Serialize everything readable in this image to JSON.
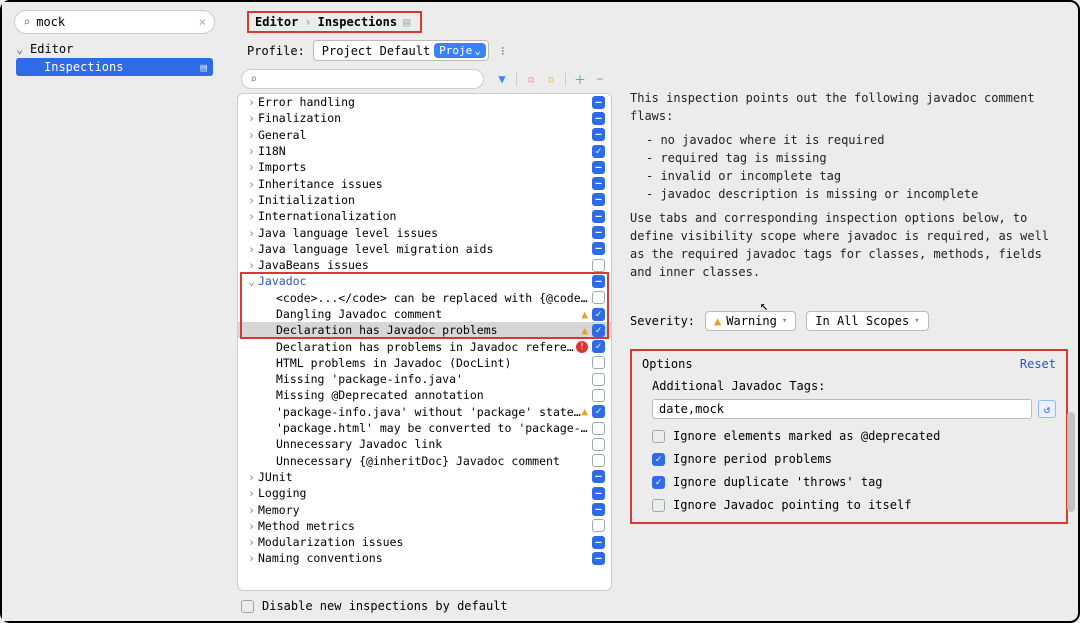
{
  "sidebar": {
    "search_value": "mock",
    "group": "Editor",
    "item": "Inspections"
  },
  "breadcrumb": {
    "root": "Editor",
    "leaf": "Inspections"
  },
  "profile": {
    "label": "Profile:",
    "name": "Project Default",
    "scope_badge": "Proje"
  },
  "tree": {
    "items": [
      {
        "label": "Error handling",
        "depth": 0,
        "expand": "right",
        "check": "mixed"
      },
      {
        "label": "Finalization",
        "depth": 0,
        "expand": "right",
        "check": "mixed"
      },
      {
        "label": "General",
        "depth": 0,
        "expand": "right",
        "check": "mixed"
      },
      {
        "label": "I18N",
        "depth": 0,
        "expand": "right",
        "check": "checked"
      },
      {
        "label": "Imports",
        "depth": 0,
        "expand": "right",
        "check": "mixed"
      },
      {
        "label": "Inheritance issues",
        "depth": 0,
        "expand": "right",
        "check": "mixed"
      },
      {
        "label": "Initialization",
        "depth": 0,
        "expand": "right",
        "check": "mixed"
      },
      {
        "label": "Internationalization",
        "depth": 0,
        "expand": "right",
        "check": "mixed"
      },
      {
        "label": "Java language level issues",
        "depth": 0,
        "expand": "right",
        "check": "mixed"
      },
      {
        "label": "Java language level migration aids",
        "depth": 0,
        "expand": "right",
        "check": "mixed"
      },
      {
        "label": "JavaBeans issues",
        "depth": 0,
        "expand": "right",
        "check": "unchecked"
      },
      {
        "label": "Javadoc",
        "depth": 0,
        "expand": "down",
        "check": "mixed",
        "link": true
      },
      {
        "label": "<code>...</code> can be replaced with {@code ...}",
        "depth": 1,
        "expand": "none",
        "check": "unchecked"
      },
      {
        "label": "Dangling Javadoc comment",
        "depth": 1,
        "expand": "none",
        "check": "checked",
        "warn": true
      },
      {
        "label": "Declaration has Javadoc problems",
        "depth": 1,
        "expand": "none",
        "check": "checked",
        "warn": true,
        "selected": true
      },
      {
        "label": "Declaration has problems in Javadoc references",
        "depth": 1,
        "expand": "none",
        "check": "checked",
        "err": true
      },
      {
        "label": "HTML problems in Javadoc (DocLint)",
        "depth": 1,
        "expand": "none",
        "check": "unchecked"
      },
      {
        "label": "Missing 'package-info.java'",
        "depth": 1,
        "expand": "none",
        "check": "unchecked"
      },
      {
        "label": "Missing @Deprecated annotation",
        "depth": 1,
        "expand": "none",
        "check": "unchecked"
      },
      {
        "label": "'package-info.java' without 'package' statement",
        "depth": 1,
        "expand": "none",
        "check": "checked",
        "warn": true
      },
      {
        "label": "'package.html' may be converted to 'package-info.java'",
        "depth": 1,
        "expand": "none",
        "check": "unchecked"
      },
      {
        "label": "Unnecessary Javadoc link",
        "depth": 1,
        "expand": "none",
        "check": "unchecked"
      },
      {
        "label": "Unnecessary {@inheritDoc} Javadoc comment",
        "depth": 1,
        "expand": "none",
        "check": "unchecked"
      },
      {
        "label": "JUnit",
        "depth": 0,
        "expand": "right",
        "check": "mixed"
      },
      {
        "label": "Logging",
        "depth": 0,
        "expand": "right",
        "check": "mixed"
      },
      {
        "label": "Memory",
        "depth": 0,
        "expand": "right",
        "check": "mixed"
      },
      {
        "label": "Method metrics",
        "depth": 0,
        "expand": "right",
        "check": "unchecked"
      },
      {
        "label": "Modularization issues",
        "depth": 0,
        "expand": "right",
        "check": "mixed"
      },
      {
        "label": "Naming conventions",
        "depth": 0,
        "expand": "right",
        "check": "mixed"
      }
    ],
    "footer_label": "Disable new inspections by default"
  },
  "detail": {
    "intro": "This inspection points out the following javadoc comment flaws:",
    "bullets": [
      "no javadoc where it is required",
      "required tag is missing",
      "invalid or incomplete tag",
      "javadoc description is missing or incomplete"
    ],
    "para": "Use tabs and corresponding inspection options below, to define visibility scope where javadoc is required, as well as the required javadoc tags for classes, methods, fields and inner classes.",
    "severity_label": "Severity:",
    "severity_value": "Warning",
    "scope_value": "In All Scopes",
    "options_title": "Options",
    "reset": "Reset",
    "addl_tags_label": "Additional Javadoc Tags:",
    "addl_tags_value": "date,mock",
    "checks": [
      {
        "label": "Ignore elements marked as @deprecated",
        "checked": false
      },
      {
        "label": "Ignore period problems",
        "checked": true
      },
      {
        "label": "Ignore duplicate 'throws' tag",
        "checked": true
      },
      {
        "label": "Ignore Javadoc pointing to itself",
        "checked": false
      }
    ]
  }
}
